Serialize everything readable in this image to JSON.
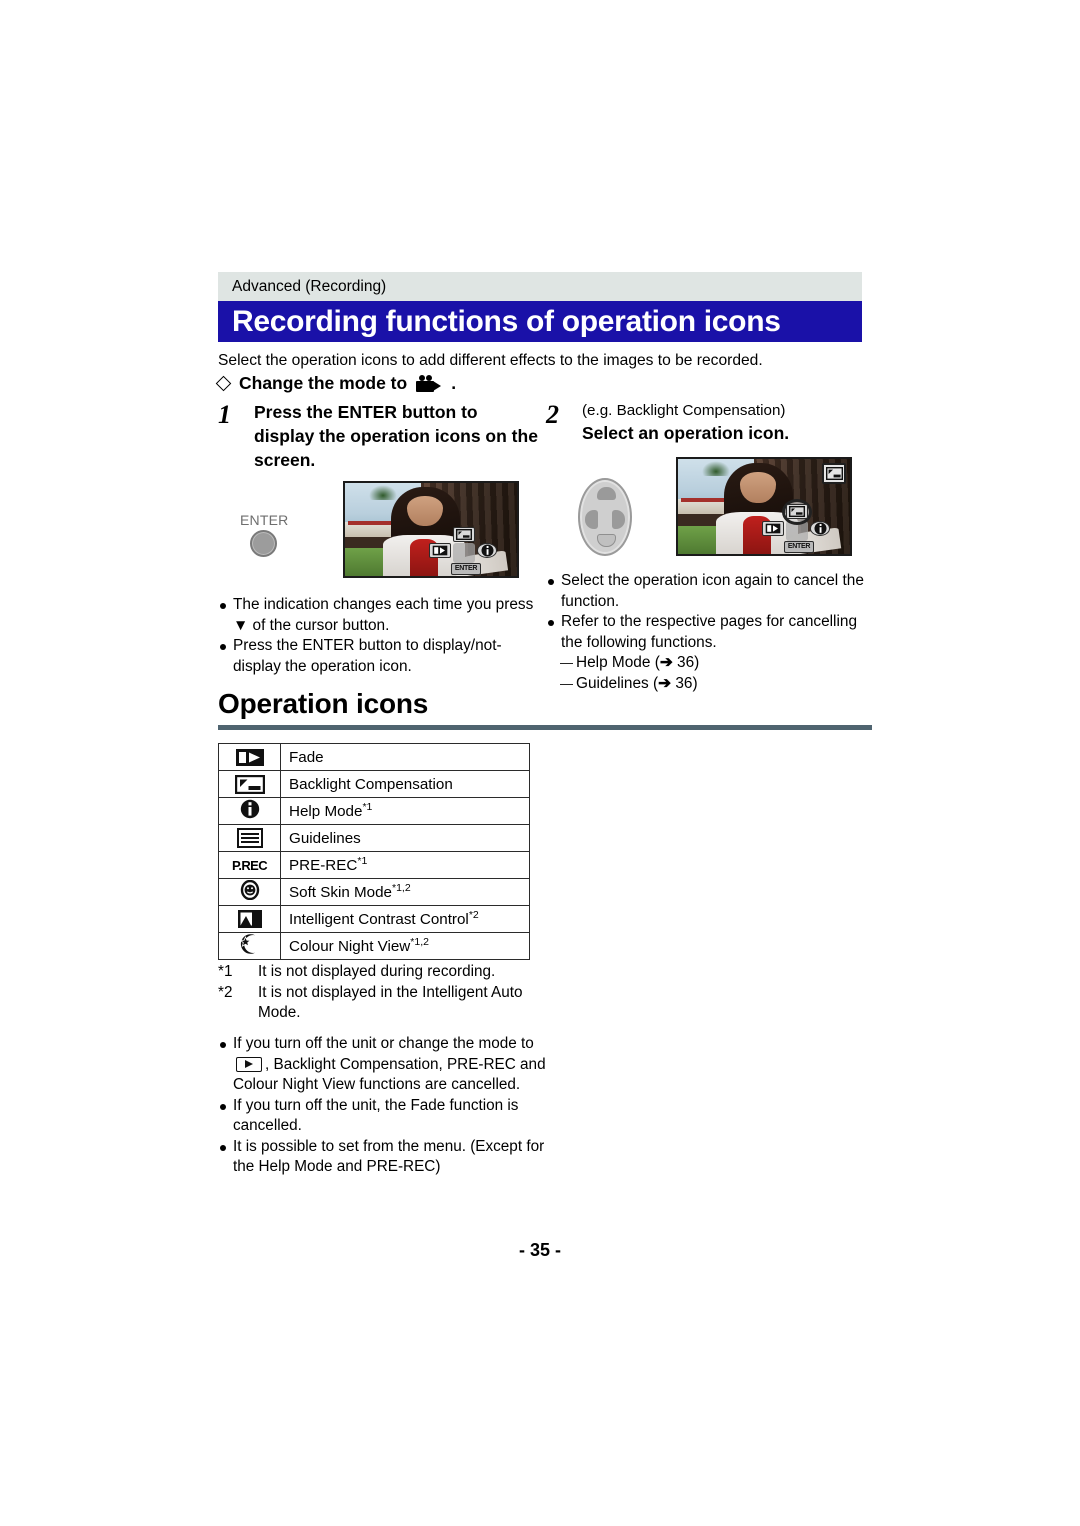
{
  "header": {
    "section_tag": "Advanced (Recording)",
    "title": "Recording functions of operation icons",
    "title_bar_color": "#1a11a8",
    "tag_bg_color": "#dfe5e3"
  },
  "intro": "Select the operation icons to add different effects to the images to be recorded.",
  "mode_line": {
    "prefix": "Change the mode to",
    "icon": "movie-record-mode-icon",
    "suffix": "."
  },
  "steps": [
    {
      "number": "1",
      "heading": "Press the ENTER button to display the operation icons on the screen.",
      "sub": "",
      "graphic_label": "ENTER"
    },
    {
      "number": "2",
      "sub": "(e.g. Backlight Compensation)",
      "heading": "Select an operation icon."
    }
  ],
  "bullets_left": [
    "The indication changes each time you press ▼ of the cursor button.",
    "Press the ENTER button to display/not-display the operation icon."
  ],
  "bullets_right": [
    "Select the operation icon again to cancel the function.",
    "Refer to the respective pages for cancelling the following functions."
  ],
  "bullets_right_sub": [
    {
      "label": "Help Mode",
      "ref": "36"
    },
    {
      "label": "Guidelines",
      "ref": "36"
    }
  ],
  "section2": {
    "heading": "Operation icons",
    "rule_color": "#4f6470"
  },
  "op_table": {
    "rows": [
      {
        "icon": "fade-icon",
        "label": "Fade",
        "sup": ""
      },
      {
        "icon": "backlight-comp-icon",
        "label": "Backlight Compensation",
        "sup": ""
      },
      {
        "icon": "help-mode-icon",
        "label": "Help Mode",
        "sup": "*1"
      },
      {
        "icon": "guidelines-icon",
        "label": "Guidelines",
        "sup": ""
      },
      {
        "icon": "pre-rec-icon",
        "label": "PRE-REC",
        "sup": "*1",
        "icon_text": "P.REC"
      },
      {
        "icon": "soft-skin-mode-icon",
        "label": "Soft Skin Mode",
        "sup": "*1,2"
      },
      {
        "icon": "contrast-control-icon",
        "label": "Intelligent Contrast Control",
        "sup": "*2"
      },
      {
        "icon": "colour-night-view-icon",
        "label": "Colour Night View",
        "sup": "*1,2"
      }
    ]
  },
  "footnotes": [
    {
      "key": "*1",
      "text": "It is not displayed during recording."
    },
    {
      "key": "*2",
      "text": "It is not displayed in the Intelligent Auto Mode."
    }
  ],
  "notes": [
    "If you turn off the unit or change the mode to",
    ", Backlight Compensation, PRE-REC and Colour Night View functions are cancelled.",
    "If you turn off the unit, the Fade function is cancelled.",
    "It is possible to set from the menu. (Except for the Help Mode and PRE-REC)"
  ],
  "page_number": "- 35 -"
}
